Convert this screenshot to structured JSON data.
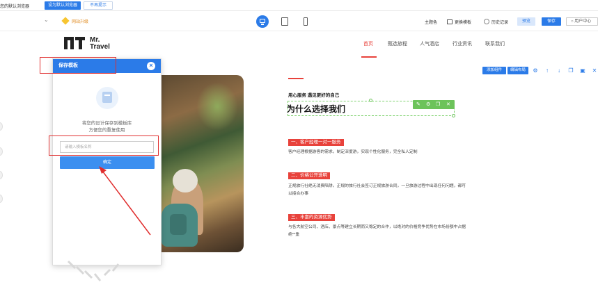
{
  "notice": {
    "text": "您的默认浏览器",
    "set_default_btn": "设为默认浏览器",
    "dismiss_btn": "不再提示"
  },
  "toolbar": {
    "dropdown_icon": "chevron-down-icon",
    "upgrade_label": "网站升级",
    "devices": [
      "desktop-icon",
      "tablet-icon",
      "phone-icon"
    ],
    "theme_color": "主题色",
    "change_template": "更换模板",
    "history": "历史记录",
    "preview": "预览",
    "save": "保存",
    "user_center": "用户中心",
    "accent_color": "#2b7be8"
  },
  "site": {
    "logo": {
      "line1": "Mr.",
      "line2": "Travel"
    },
    "nav": [
      {
        "label": "首页",
        "active": true
      },
      {
        "label": "甄选旅程",
        "active": false
      },
      {
        "label": "人气酒店",
        "active": false
      },
      {
        "label": "行业资讯",
        "active": false
      },
      {
        "label": "联系我们",
        "active": false
      }
    ],
    "brand_color": "#e8423b"
  },
  "dialog": {
    "title": "保存模板",
    "close_icon": "close-icon",
    "description_line1": "将您的设计保存到模板库",
    "description_line2": "方便您的重复使用",
    "input_placeholder": "请输入模板名称",
    "input_value": "",
    "confirm": "确定"
  },
  "content": {
    "subheading": "用心服务 遇见更好的自己",
    "title": "为什么选择我们",
    "sections": [
      {
        "tag": "一、客户经理一对一服务",
        "text": "客户经理根据游客的需求，制定深度游，实现个性化服务，完全私人定制"
      },
      {
        "tag": "二、价格公开透明",
        "text": "正规旅行社绝无消费陷阱。正规的旅行社会签订正规旅游合同，一旦旅游过程中出现任何问题，都可以接合办事"
      },
      {
        "tag": "三、丰富的资源优势",
        "text": "与各大航空公司、酒店、景点等建立长期而又稳定的合作，以绝对的价格竞争优势在市场份额中占据绝**重"
      }
    ]
  },
  "element_tools": {
    "add_component": "添加组件",
    "edit_layout": "编辑布局",
    "icons": [
      "gear-icon",
      "arrow-up-icon",
      "arrow-down-icon",
      "copy-icon",
      "save-icon",
      "close-icon"
    ],
    "selection_tools": [
      "edit-icon",
      "settings-icon",
      "copy-icon",
      "close-icon"
    ],
    "selection_color": "#6cc35a"
  }
}
